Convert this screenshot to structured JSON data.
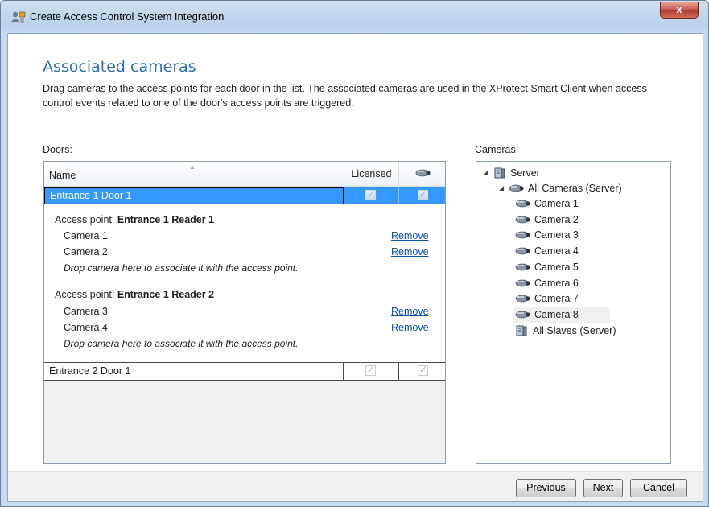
{
  "window": {
    "title": "Create Access Control System Integration",
    "close_label": "x"
  },
  "page": {
    "heading": "Associated cameras",
    "description": "Drag cameras to the access points for each door in the list. The associated cameras are used in the XProtect Smart Client when access control events related to one of the door's access points are triggered."
  },
  "doors": {
    "label": "Doors:",
    "columns": {
      "name": "Name",
      "licensed": "Licensed",
      "camera_icon": "camera-icon"
    },
    "rows": [
      {
        "name": "Entrance 1 Door 1",
        "licensed": true,
        "camera": true,
        "selected": true
      },
      {
        "name": "Entrance 2 Door 1",
        "licensed": true,
        "camera": true,
        "selected": false
      }
    ],
    "detail": {
      "access_point_prefix": "Access point:",
      "access_points": [
        {
          "name": "Entrance 1 Reader 1",
          "cameras": [
            "Camera 1",
            "Camera 2"
          ]
        },
        {
          "name": "Entrance 1 Reader 2",
          "cameras": [
            "Camera 3",
            "Camera 4"
          ]
        }
      ],
      "remove_label": "Remove",
      "drop_hint": "Drop camera here to associate it with the access point."
    }
  },
  "cameras": {
    "label": "Cameras:",
    "tree": {
      "server": "Server",
      "group": "All Cameras (Server)",
      "items": [
        "Camera 1",
        "Camera 2",
        "Camera 3",
        "Camera 4",
        "Camera 5",
        "Camera 6",
        "Camera 7",
        "Camera 8"
      ],
      "slaves": "All Slaves (Server)",
      "hovered_item": "Camera 8"
    }
  },
  "buttons": {
    "previous": "Previous",
    "next": "Next",
    "cancel": "Cancel"
  },
  "colors": {
    "heading": "#2e6eb5",
    "selection": "#3399ff",
    "link": "#0d4fb5"
  }
}
